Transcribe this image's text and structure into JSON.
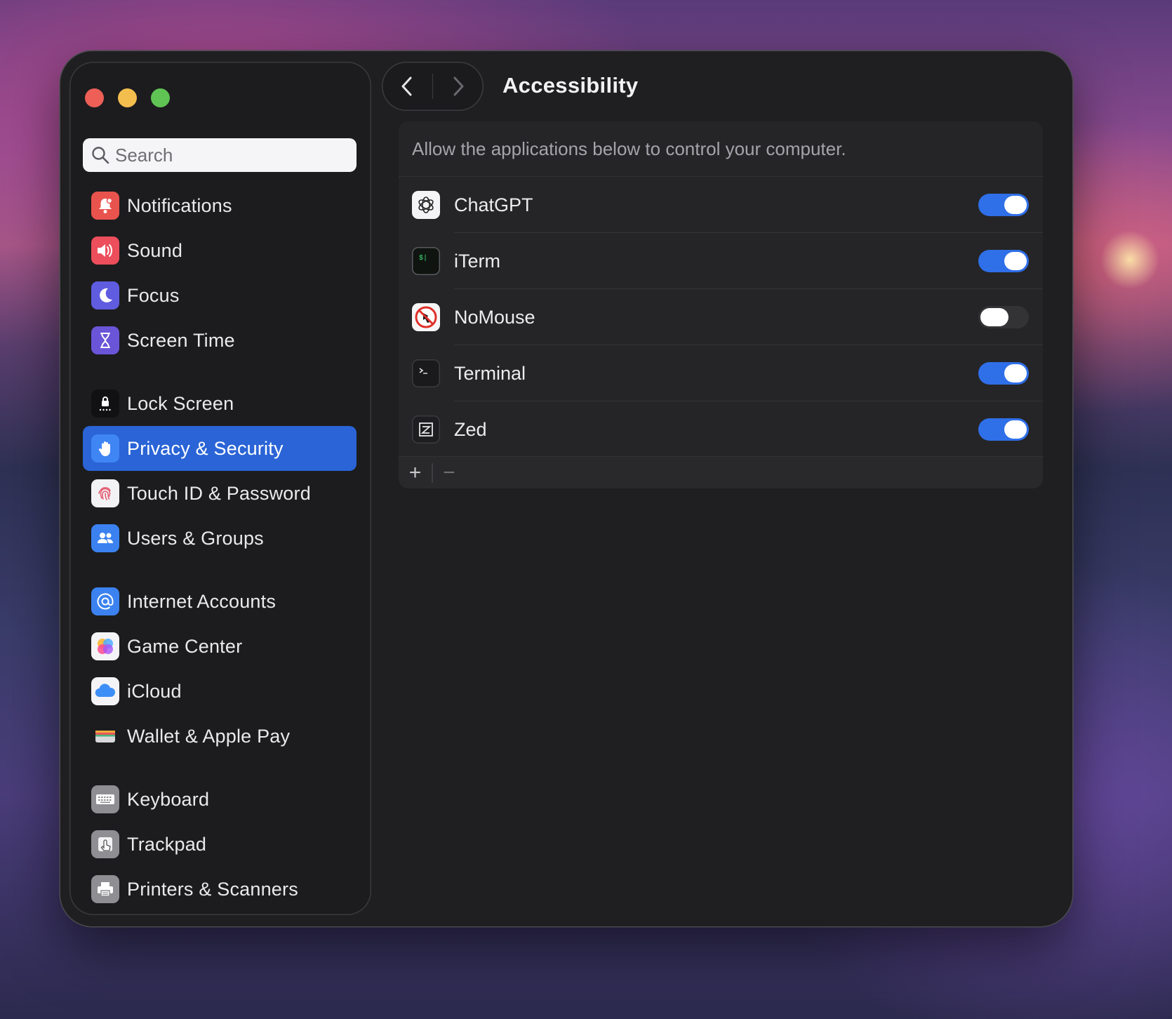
{
  "window": {
    "title": "Accessibility"
  },
  "search": {
    "placeholder": "Search"
  },
  "sidebar": {
    "groups": [
      [
        {
          "label": "Notifications",
          "icon": "bell-icon",
          "color": "#e9534d"
        },
        {
          "label": "Sound",
          "icon": "speaker-icon",
          "color": "#ec4e5b"
        },
        {
          "label": "Focus",
          "icon": "moon-icon",
          "color": "#5f5ce0"
        },
        {
          "label": "Screen Time",
          "icon": "hourglass-icon",
          "color": "#6a55d8"
        }
      ],
      [
        {
          "label": "Lock Screen",
          "icon": "lock-icon",
          "color": "#111113"
        },
        {
          "label": "Privacy & Security",
          "icon": "hand-icon",
          "color": "#3f86f4",
          "selected": true
        },
        {
          "label": "Touch ID & Password",
          "icon": "fingerprint-icon",
          "color": "#f2f2f4"
        },
        {
          "label": "Users & Groups",
          "icon": "users-icon",
          "color": "#3b82f0"
        }
      ],
      [
        {
          "label": "Internet Accounts",
          "icon": "at-icon",
          "color": "#3b82f0"
        },
        {
          "label": "Game Center",
          "icon": "game-center-icon",
          "color": "#f4f4f6"
        },
        {
          "label": "iCloud",
          "icon": "cloud-icon",
          "color": "#f4f4f6"
        },
        {
          "label": "Wallet & Apple Pay",
          "icon": "wallet-icon",
          "color": "#1c1c1e"
        }
      ],
      [
        {
          "label": "Keyboard",
          "icon": "keyboard-icon",
          "color": "#8e8e93"
        },
        {
          "label": "Trackpad",
          "icon": "trackpad-icon",
          "color": "#8e8e93"
        },
        {
          "label": "Printers & Scanners",
          "icon": "printer-icon",
          "color": "#8e8e93"
        }
      ]
    ]
  },
  "accessibility": {
    "description": "Allow the applications below to control your computer.",
    "apps": [
      {
        "name": "ChatGPT",
        "icon": "chatgpt-icon",
        "enabled": true
      },
      {
        "name": "iTerm",
        "icon": "iterm-icon",
        "enabled": true
      },
      {
        "name": "NoMouse",
        "icon": "nomouse-icon",
        "enabled": false
      },
      {
        "name": "Terminal",
        "icon": "terminal-icon",
        "enabled": true
      },
      {
        "name": "Zed",
        "icon": "zed-icon",
        "enabled": true
      }
    ],
    "add_label": "+",
    "remove_label": "−"
  },
  "colors": {
    "accent": "#2f6fe8",
    "selection": "#2a64d6"
  }
}
